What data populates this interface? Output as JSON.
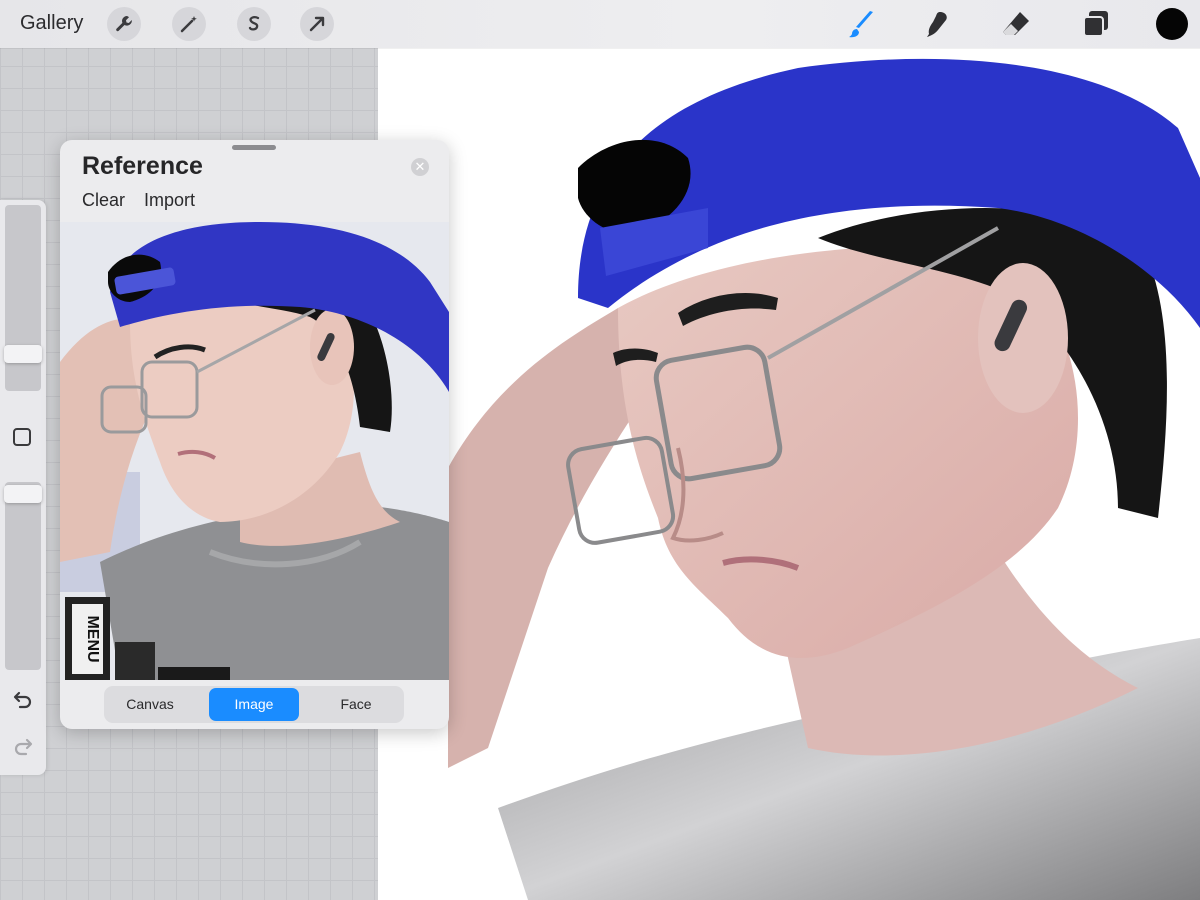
{
  "toolbar": {
    "gallery_label": "Gallery",
    "left_tools": [
      "wrench-icon",
      "magic-wand-icon",
      "selection-icon",
      "transform-arrow-icon"
    ],
    "right_tools": [
      "brush-icon",
      "smudge-icon",
      "eraser-icon",
      "layers-icon"
    ],
    "active_tool": "brush-icon",
    "active_color": "#050505",
    "accent_color": "#1a8cff"
  },
  "sidebar": {
    "icons": [
      "undo-icon",
      "redo-icon",
      "modify-square-icon"
    ]
  },
  "reference_panel": {
    "title": "Reference",
    "clear_label": "Clear",
    "import_label": "Import",
    "segments": [
      "Canvas",
      "Image",
      "Face"
    ],
    "active_segment": "Image",
    "photo_sign_text": "MENU"
  }
}
